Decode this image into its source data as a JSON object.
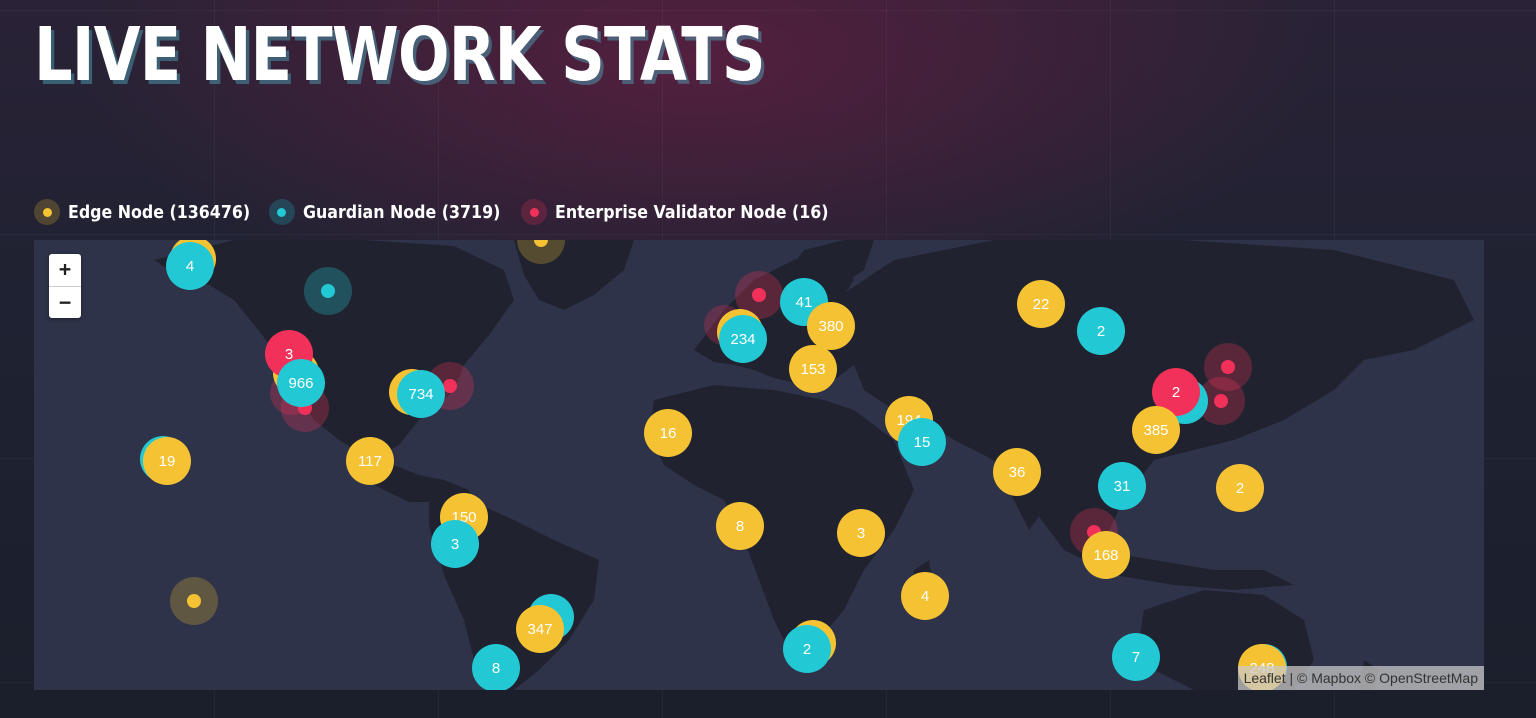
{
  "title": "LIVE NETWORK STATS",
  "legend": [
    {
      "label": "Edge Node (136476)",
      "color": "#f5c233"
    },
    {
      "label": "Guardian Node (3719)",
      "color": "#22c9d4"
    },
    {
      "label": "Enterprise Validator Node (16)",
      "color": "#f2315a"
    }
  ],
  "colors": {
    "edge": "#f5c233",
    "guardian": "#22c9d4",
    "enterprise": "#f2315a"
  },
  "zoom": {
    "in_label": "+",
    "out_label": "−"
  },
  "clusters": [
    {
      "label": "4",
      "type": "guardian"
    },
    {
      "label": "3",
      "type": "enterprise"
    },
    {
      "label": "966",
      "type": "guardian"
    },
    {
      "label": "734",
      "type": "guardian"
    },
    {
      "label": "19",
      "type": "edge"
    },
    {
      "label": "117",
      "type": "edge"
    },
    {
      "label": "150",
      "type": "edge"
    },
    {
      "label": "3",
      "type": "guardian"
    },
    {
      "label": "347",
      "type": "edge"
    },
    {
      "label": "8",
      "type": "guardian"
    },
    {
      "label": "41",
      "type": "guardian"
    },
    {
      "label": "380",
      "type": "edge"
    },
    {
      "label": "234",
      "type": "guardian"
    },
    {
      "label": "153",
      "type": "edge"
    },
    {
      "label": "16",
      "type": "edge"
    },
    {
      "label": "194",
      "type": "edge"
    },
    {
      "label": "15",
      "type": "guardian"
    },
    {
      "label": "8",
      "type": "edge"
    },
    {
      "label": "3",
      "type": "edge"
    },
    {
      "label": "4",
      "type": "edge"
    },
    {
      "label": "2",
      "type": "guardian"
    },
    {
      "label": "22",
      "type": "edge"
    },
    {
      "label": "2",
      "type": "guardian"
    },
    {
      "label": "36",
      "type": "edge"
    },
    {
      "label": "31",
      "type": "guardian"
    },
    {
      "label": "168",
      "type": "edge"
    },
    {
      "label": "2",
      "type": "enterprise"
    },
    {
      "label": "385",
      "type": "edge"
    },
    {
      "label": "2",
      "type": "edge"
    },
    {
      "label": "7",
      "type": "guardian"
    },
    {
      "label": "248",
      "type": "edge"
    }
  ],
  "attribution": {
    "leaflet": "Leaflet",
    "separator": " | © ",
    "mapbox": "Mapbox",
    "osm_prefix": " © ",
    "osm": "OpenStreetMap"
  }
}
